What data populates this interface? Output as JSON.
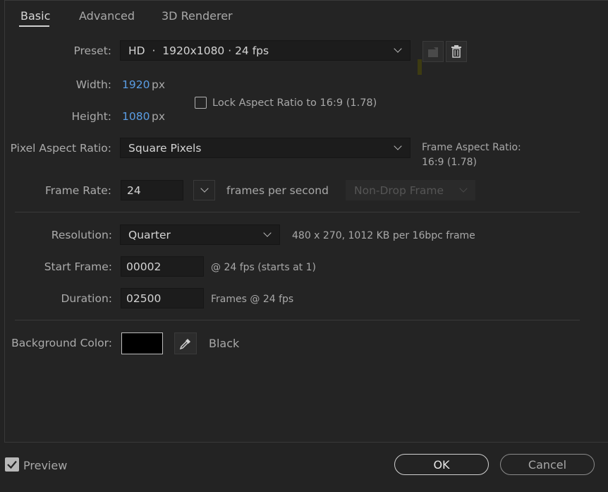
{
  "tabs": [
    {
      "label": "Basic",
      "active": true
    },
    {
      "label": "Advanced",
      "active": false
    },
    {
      "label": "3D Renderer",
      "active": false
    }
  ],
  "preset": {
    "label": "Preset:",
    "value": "HD  ·  1920x1080 · 24 fps"
  },
  "width": {
    "label": "Width:",
    "value": "1920",
    "unit": "px"
  },
  "height": {
    "label": "Height:",
    "value": "1080",
    "unit": "px"
  },
  "lock_aspect": {
    "label": "Lock Aspect Ratio to 16:9 (1.78)",
    "checked": false
  },
  "pixel_aspect": {
    "label": "Pixel Aspect Ratio:",
    "value": "Square Pixels"
  },
  "frame_aspect": {
    "label": "Frame Aspect Ratio:",
    "value": "16:9 (1.78)"
  },
  "frame_rate": {
    "label": "Frame Rate:",
    "value": "24",
    "unit": "frames per second",
    "drop_frame": "Non-Drop Frame"
  },
  "resolution": {
    "label": "Resolution:",
    "value": "Quarter",
    "info": "480 x 270, 1012 KB per 16bpc frame"
  },
  "start_frame": {
    "label": "Start Frame:",
    "value": "00002",
    "info": "@ 24 fps (starts at 1)"
  },
  "duration": {
    "label": "Duration:",
    "value": "02500",
    "info": "Frames @ 24 fps"
  },
  "background": {
    "label": "Background Color:",
    "color": "#000000",
    "name": "Black"
  },
  "preview": {
    "label": "Preview",
    "checked": true
  },
  "buttons": {
    "ok": "OK",
    "cancel": "Cancel"
  },
  "colors": {
    "accent_blue": "#5a9de4",
    "background": "#232323"
  }
}
